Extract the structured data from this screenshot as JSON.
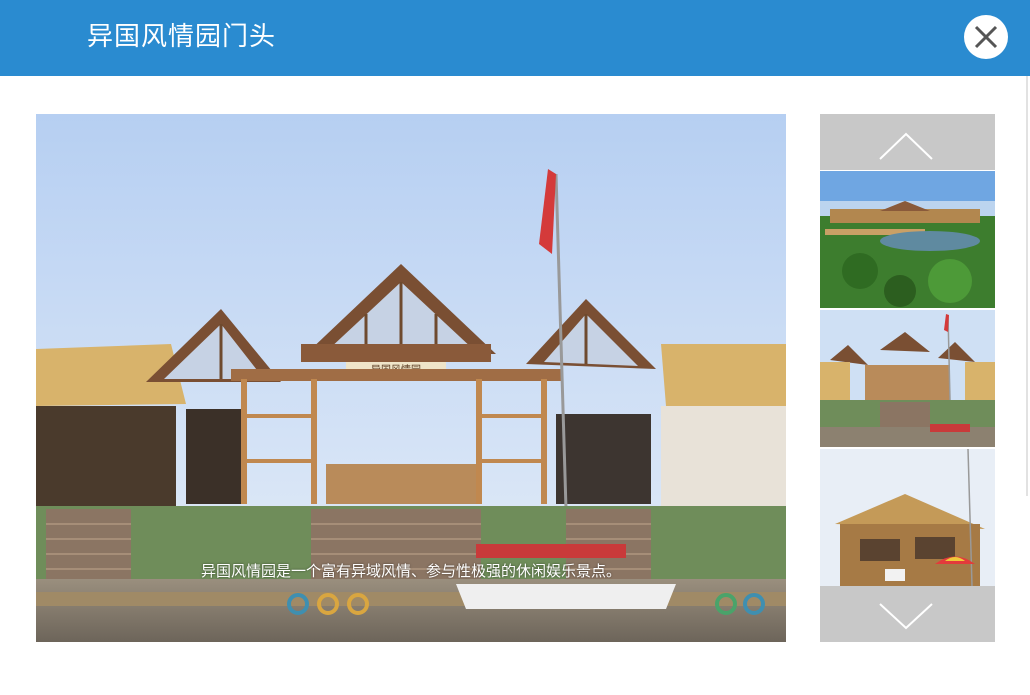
{
  "dialog": {
    "title": "异国风情园门头",
    "close_icon": "close-icon",
    "header_color": "#2a8bd0"
  },
  "viewer": {
    "caption": "异国风情园是一个富有异域风情、参与性极强的休闲娱乐景点。",
    "main_image": "exotic-park-gate-photo",
    "main_sign_text": "异国风情园"
  },
  "thumbnails": {
    "up_icon": "chevron-up-icon",
    "down_icon": "chevron-down-icon",
    "items": [
      {
        "image": "lotus-pond-pavilion-photo"
      },
      {
        "image": "exotic-park-gate-photo"
      },
      {
        "image": "wooden-hut-umbrella-photo"
      }
    ]
  }
}
